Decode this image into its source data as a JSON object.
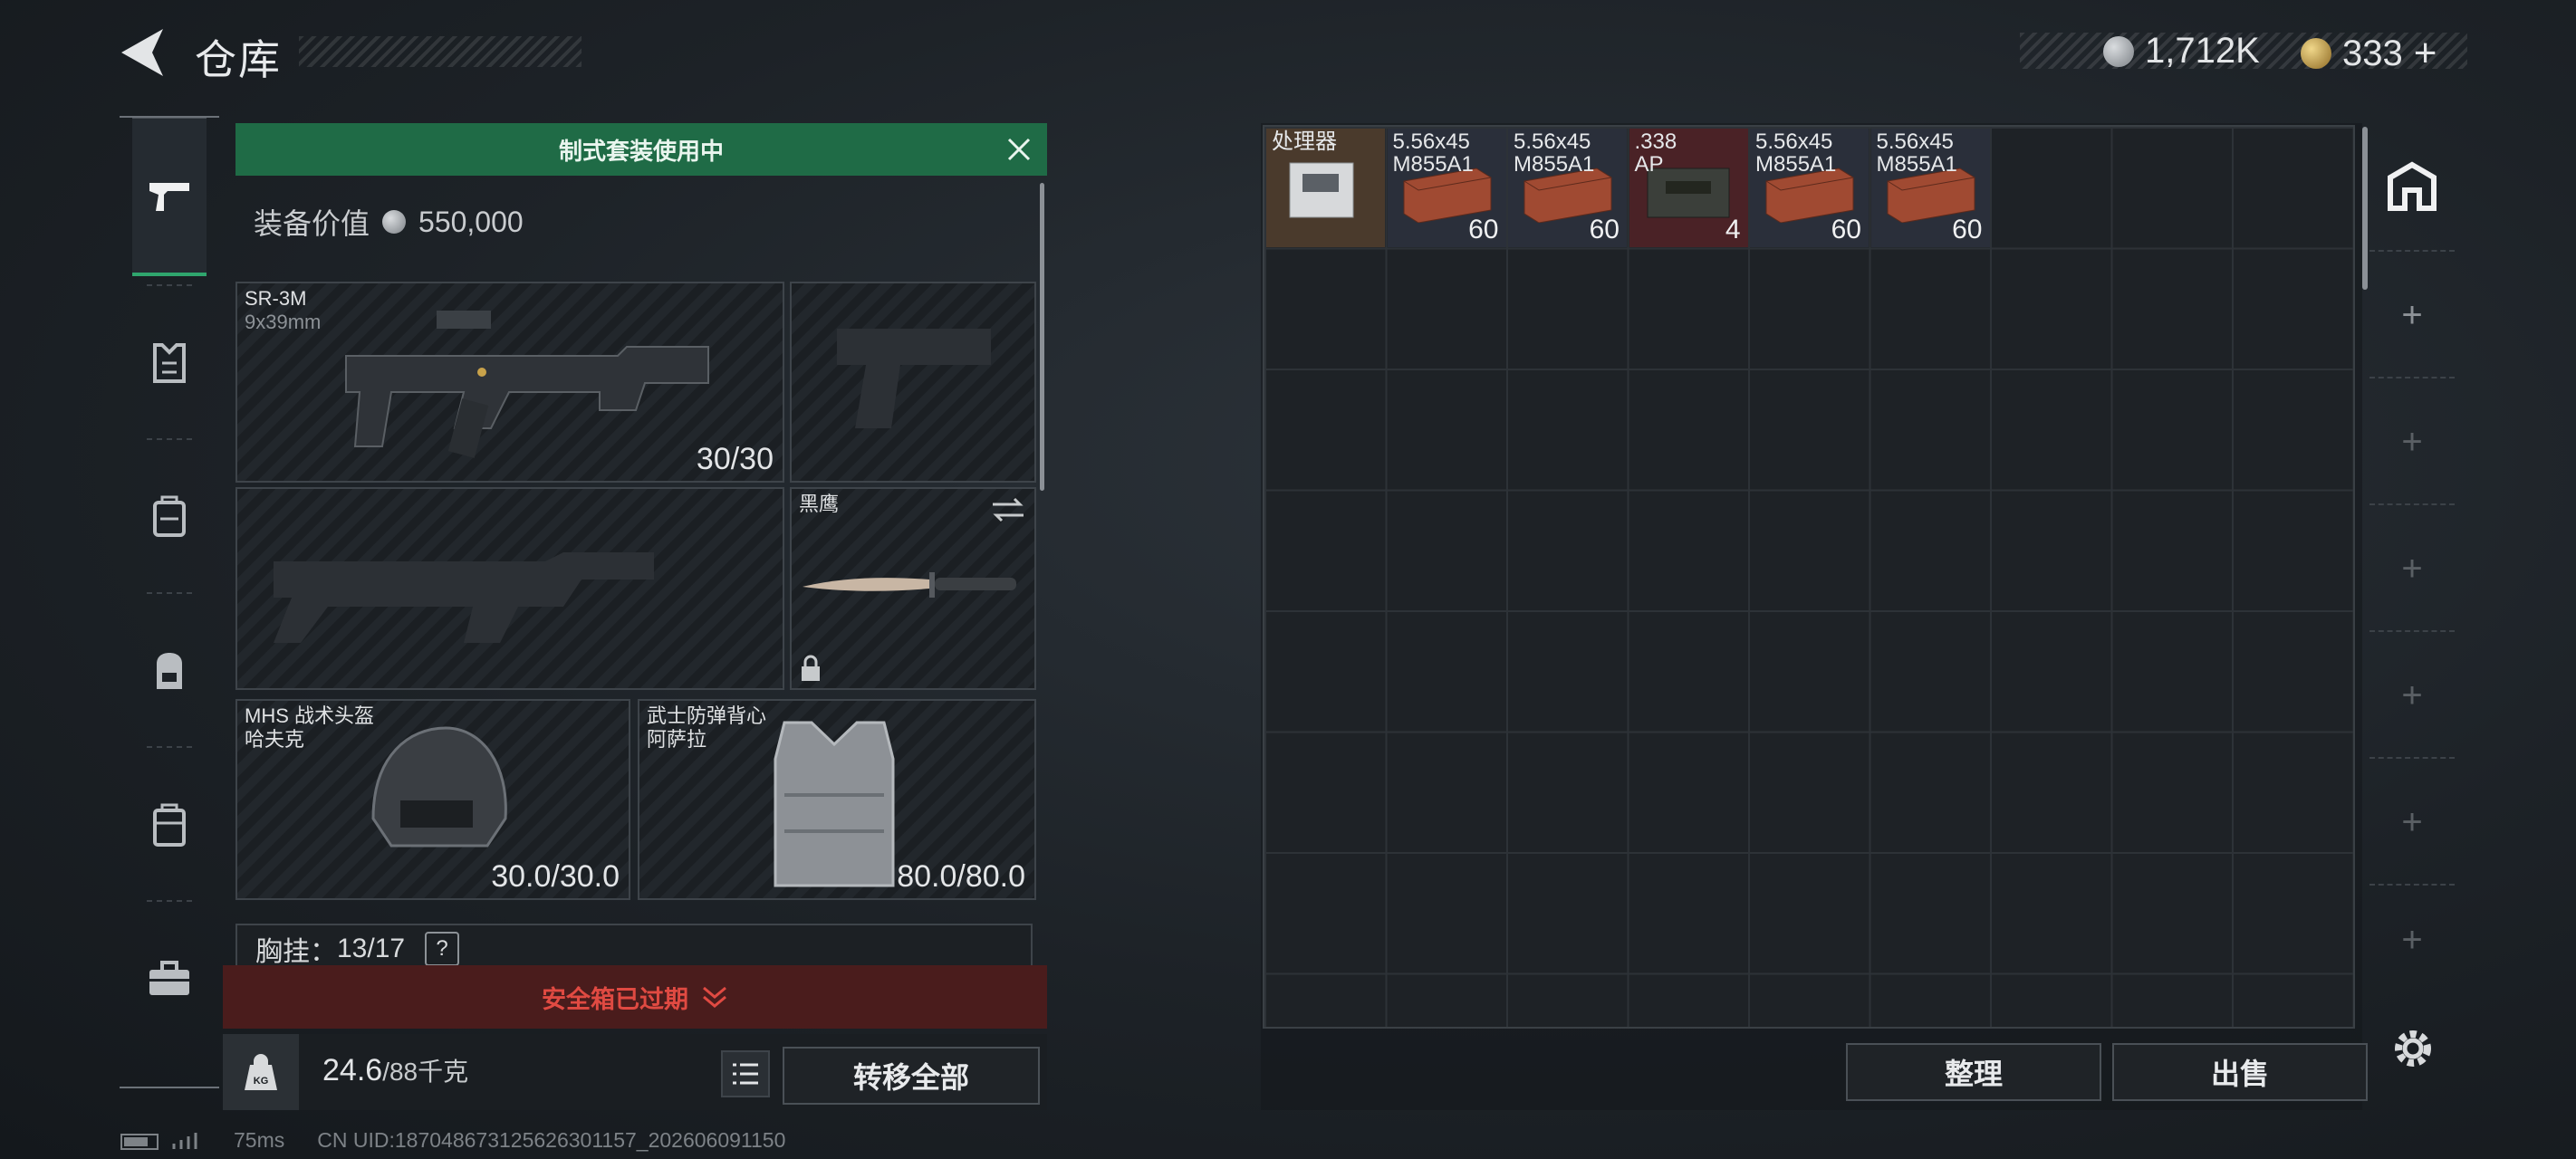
{
  "header": {
    "title": "仓库",
    "currency_silver": "1,712K",
    "currency_gold": "333",
    "gold_add_symbol": "+"
  },
  "sidebar": {
    "tabs": [
      {
        "icon": "pistol-icon",
        "active": true
      },
      {
        "icon": "vest-icon",
        "active": false
      },
      {
        "icon": "rig-icon",
        "active": false
      },
      {
        "icon": "backpack-icon",
        "active": false
      },
      {
        "icon": "case-icon",
        "active": false
      },
      {
        "icon": "toolbox-icon",
        "active": false
      }
    ]
  },
  "loadout": {
    "kit_banner": "制式套装使用中",
    "value_label": "装备价值",
    "value_amount": "550,000",
    "primary": {
      "name": "SR-3M",
      "caliber": "9x39mm",
      "ammo": "30/30"
    },
    "knife": {
      "name": "黑鹰"
    },
    "helmet": {
      "name": "MHS 战术头盔",
      "brand": "哈夫克",
      "durability": "30.0/30.0"
    },
    "armor": {
      "name": "武士防弹背心",
      "brand": "阿萨拉",
      "durability": "80.0/80.0"
    },
    "chest_rig_label": "胸挂：",
    "chest_rig_count": "13/17",
    "chest_rig_help": "?",
    "safebox_status": "安全箱已过期",
    "weight_value": "24.6",
    "weight_capacity": "/88千克",
    "kg_icon_text": "KG",
    "transfer_all": "转移全部"
  },
  "storage": {
    "items": [
      {
        "label": "处理器",
        "count": "",
        "bg": "#4a3a2c"
      },
      {
        "label": "5.56x45\nM855A1",
        "count": "60",
        "bg": "#2a2f3a"
      },
      {
        "label": "5.56x45\nM855A1",
        "count": "60",
        "bg": "#2a2f3a"
      },
      {
        "label": ".338\nAP",
        "count": "4",
        "bg": "#4a2226"
      },
      {
        "label": "5.56x45\nM855A1",
        "count": "60",
        "bg": "#2a2f3a"
      },
      {
        "label": "5.56x45\nM855A1",
        "count": "60",
        "bg": "#2a2f3a"
      }
    ],
    "sort_button": "整理",
    "sell_button": "出售"
  },
  "rail": {
    "plus": "+"
  },
  "status": {
    "ping": "75ms",
    "uid": "CN UID:187048673125626301157_202606091150"
  },
  "colors": {
    "accent_green": "#1f6b46",
    "alert_red": "#e04a42",
    "silver": "#a7abaf",
    "gold": "#c9a24a"
  }
}
